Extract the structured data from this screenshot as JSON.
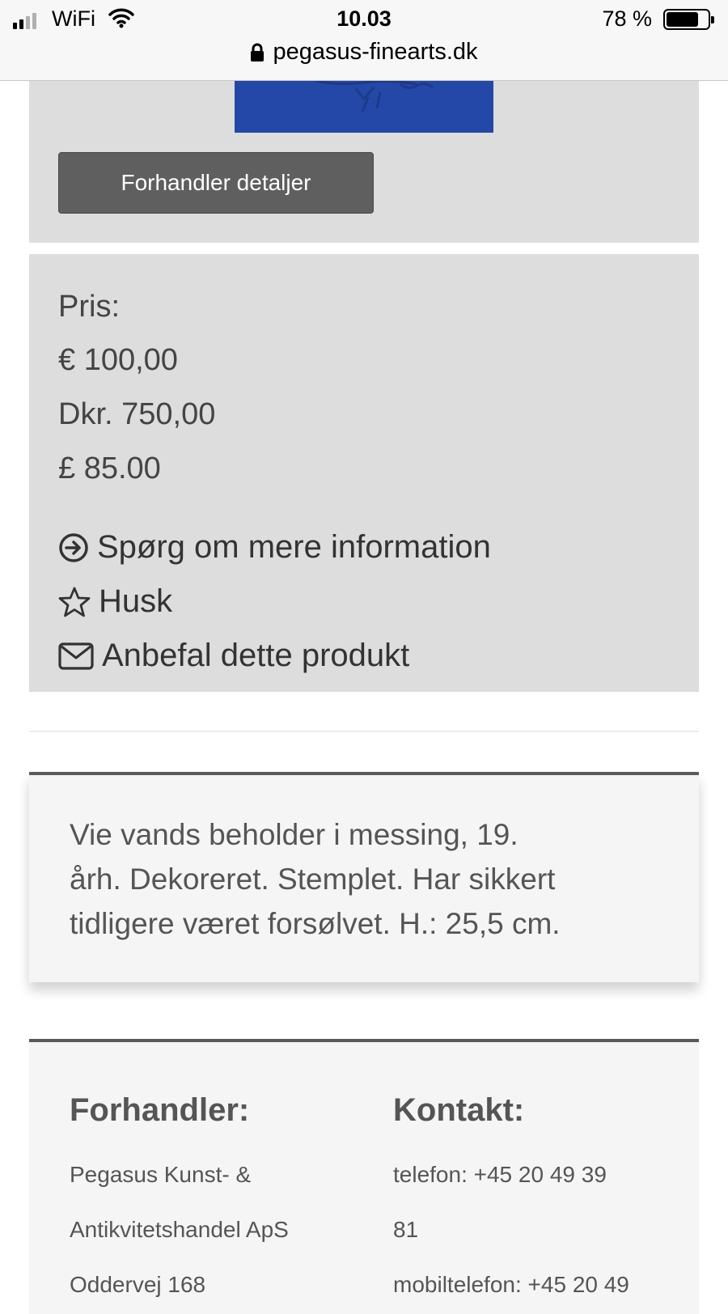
{
  "status_bar": {
    "carrier": "WiFi",
    "time": "10.03",
    "battery": "78 %",
    "battery_level": 0.78,
    "url": "pegasus-finearts.dk"
  },
  "top_card": {
    "dealer_button_label": "Forhandler detaljer"
  },
  "price": {
    "heading": "Pris:",
    "eur": "€ 100,00",
    "dkk": "Dkr. 750,00",
    "gbp": "£ 85.00"
  },
  "actions": {
    "ask": "Spørg om mere information",
    "remember": "Husk",
    "recommend": "Anbefal dette produkt"
  },
  "description": {
    "line1": "Vie vands beholder i messing, 19.",
    "line2": "årh. Dekoreret. Stemplet. Har sikkert",
    "line3": "tidligere været forsølvet. H.: 25,5 cm."
  },
  "dealer": {
    "heading": "Forhandler:",
    "line1": "Pegasus Kunst- &",
    "line2": "Antikvitetshandel ApS",
    "line3": "Oddervej 168"
  },
  "contact": {
    "heading": "Kontakt:",
    "line1": "telefon: +45 20 49 39",
    "line2": "81",
    "line3": "mobiltelefon: +45 20 49"
  },
  "colors": {
    "card_gray": "#dddddd",
    "button_gray": "#5f5f5f",
    "image_blue": "#2448a8",
    "panel_light": "#f5f5f5"
  }
}
